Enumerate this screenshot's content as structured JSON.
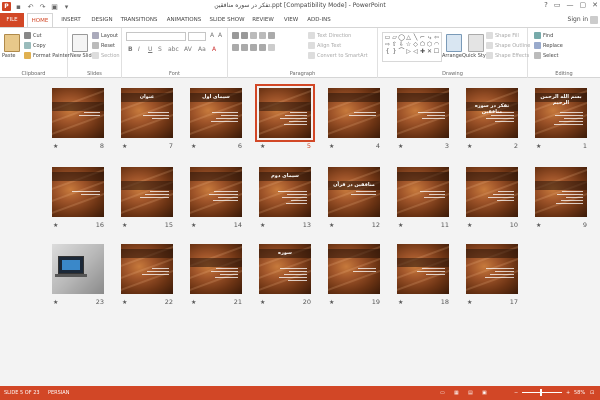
{
  "titlebar": {
    "title": "تفكر در سوره منافقين.ppt [Compatibility Mode] - PowerPoint",
    "logo": "P",
    "window_buttons": [
      "?",
      "▭",
      "—",
      "▢",
      "✕"
    ]
  },
  "tabs": [
    "FILE",
    "HOME",
    "INSERT",
    "DESIGN",
    "TRANSITIONS",
    "ANIMATIONS",
    "SLIDE SHOW",
    "REVIEW",
    "VIEW",
    "ADD-INS"
  ],
  "signin": "Sign in",
  "ribbon": {
    "clipboard": {
      "paste": "Paste",
      "cut": "Cut",
      "copy": "Copy",
      "format_painter": "Format Painter",
      "label": "Clipboard"
    },
    "slides": {
      "new_slide": "New Slide",
      "layout": "Layout",
      "reset": "Reset",
      "section": "Section",
      "label": "Slides"
    },
    "font": {
      "label": "Font",
      "buttons": [
        "B",
        "I",
        "U",
        "S",
        "abc",
        "AV",
        "Aa",
        "A"
      ]
    },
    "paragraph": {
      "text_direction": "Text Direction",
      "align_text": "Align Text",
      "convert_smartart": "Convert to SmartArt",
      "label": "Paragraph"
    },
    "drawing": {
      "arrange": "Arrange",
      "quick_styles": "Quick Styles",
      "shape_fill": "Shape Fill",
      "shape_outline": "Shape Outline",
      "shape_effects": "Shape Effects",
      "label": "Drawing",
      "shapes": [
        "▭",
        "▱",
        "◯",
        "△",
        "╲",
        "⌐",
        "⤷",
        "⇦",
        "⇨",
        "⇧",
        "⇩",
        "☆",
        "◇",
        "⬠",
        "⬡",
        "◠",
        "{",
        "}",
        "⌒",
        "▷",
        "◁",
        "✚",
        "✕",
        "☐"
      ]
    },
    "editing": {
      "find": "Find",
      "replace": "Replace",
      "select": "Select",
      "label": "Editing"
    }
  },
  "slides": [
    {
      "num": "8",
      "title": ""
    },
    {
      "num": "7",
      "title": "عنوان"
    },
    {
      "num": "6",
      "title": "سیمای اول"
    },
    {
      "num": "5",
      "title": "",
      "selected": true
    },
    {
      "num": "4",
      "title": ""
    },
    {
      "num": "3",
      "title": ""
    },
    {
      "num": "2",
      "title": "تفکر در سوره منافقین"
    },
    {
      "num": "1",
      "title": "بسم الله الرحمن الرحيم"
    },
    {
      "num": "16",
      "title": ""
    },
    {
      "num": "15",
      "title": ""
    },
    {
      "num": "14",
      "title": ""
    },
    {
      "num": "13",
      "title": "سیمای دوم"
    },
    {
      "num": "12",
      "title": "منافقین در قرآن"
    },
    {
      "num": "11",
      "title": ""
    },
    {
      "num": "10",
      "title": ""
    },
    {
      "num": "9",
      "title": ""
    },
    {
      "num": "23",
      "title": "",
      "laptop": true
    },
    {
      "num": "22",
      "title": ""
    },
    {
      "num": "21",
      "title": ""
    },
    {
      "num": "20",
      "title": "سوره"
    },
    {
      "num": "19",
      "title": ""
    },
    {
      "num": "18",
      "title": ""
    },
    {
      "num": "17",
      "title": ""
    }
  ],
  "star_glyph": "★",
  "status": {
    "slide": "SLIDE 5 OF 23",
    "language": "PERSIAN",
    "zoom": "58%"
  },
  "colors": {
    "accent": "#d24726"
  }
}
